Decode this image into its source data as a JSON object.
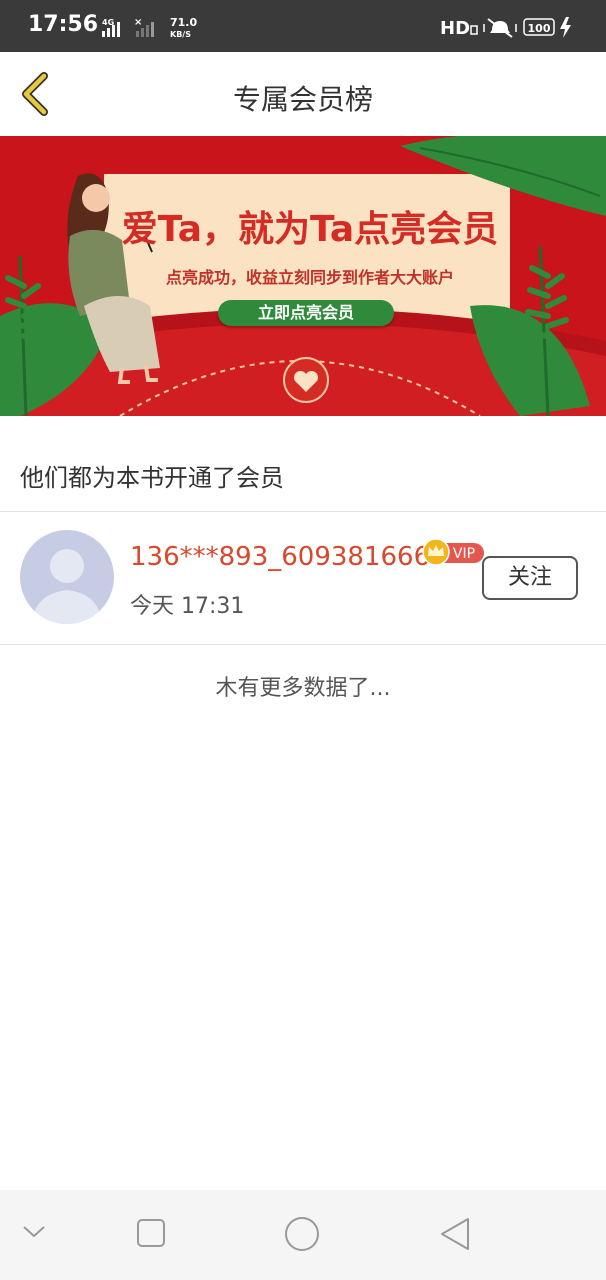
{
  "status_bar": {
    "time": "17:56",
    "network": "4G",
    "speed_value": "71.0",
    "speed_unit": "KB/S",
    "hd": "HD",
    "battery": "100"
  },
  "header": {
    "title": "专属会员榜",
    "back_icon": "chevron-left-icon"
  },
  "banner": {
    "headline": "爱Ta，就为Ta点亮会员",
    "subtitle": "点亮成功，收益立刻同步到作者大大账户",
    "button_label": "立即点亮会员"
  },
  "section": {
    "heading": "他们都为本书开通了会员"
  },
  "members": [
    {
      "name": "136***893_609381666",
      "badge": "VIP",
      "time": "今天 17:31",
      "follow_label": "关注"
    }
  ],
  "footer_note": "木有更多数据了...",
  "nav_bar": {
    "icons": [
      "chevron-down-icon",
      "square-icon",
      "circle-icon",
      "triangle-back-icon"
    ]
  },
  "colors": {
    "accent_red": "#d42c24",
    "username": "#d9472d",
    "banner_green": "#2f8a3c",
    "back_arrow": "#e8c93a"
  }
}
